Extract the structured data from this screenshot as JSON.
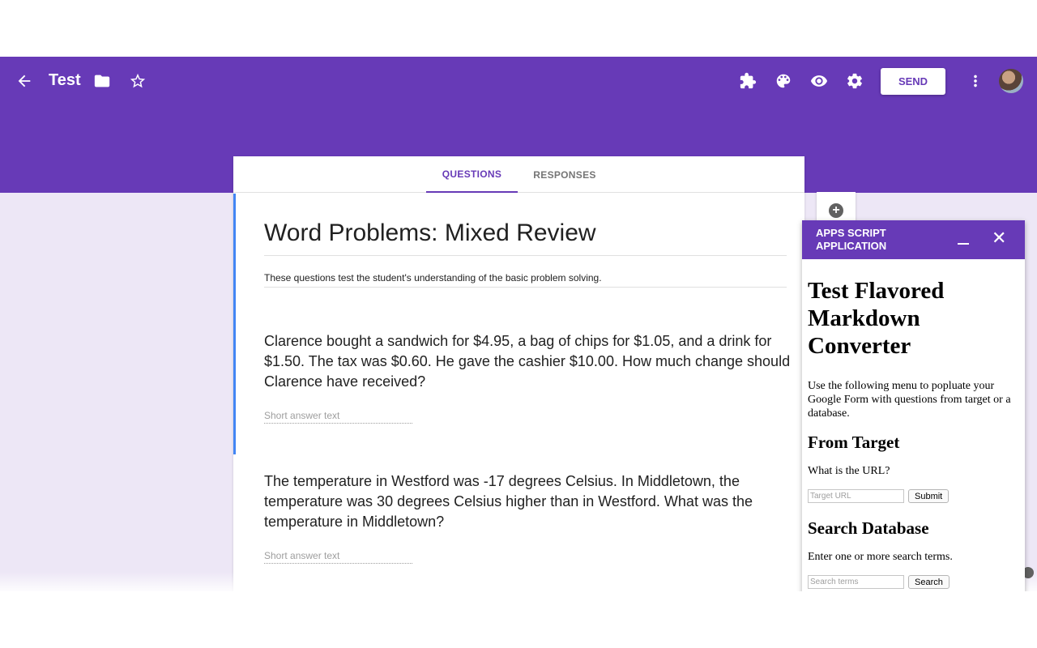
{
  "header": {
    "title": "Test",
    "send_label": "SEND",
    "icons": [
      "back-arrow-icon",
      "folder-icon",
      "star-icon",
      "addon-puzzle-icon",
      "palette-icon",
      "eye-icon",
      "gear-icon",
      "more-vert-icon"
    ]
  },
  "tabs": [
    {
      "label": "QUESTIONS",
      "active": true
    },
    {
      "label": "RESPONSES",
      "active": false
    }
  ],
  "form": {
    "title": "Word Problems: Mixed Review",
    "description": "These questions test the student's understanding of the basic problem solving.",
    "questions": [
      {
        "text": "Clarence bought a sandwich for $4.95, a bag of chips for $1.05, and a drink for $1.50. The tax was $0.60. He gave the cashier $10.00. How much change should Clarence have received?",
        "answer_placeholder": "Short answer text"
      },
      {
        "text": "The temperature in Westford was -17 degrees Celsius. In Middletown, the temperature was 30 degrees Celsius higher than in Westford. What was the temperature in Middletown?",
        "answer_placeholder": "Short answer text"
      }
    ]
  },
  "sidebar": {
    "title": "APPS SCRIPT APPLICATION",
    "heading": "Test Flavored Markdown Converter",
    "intro": "Use the following menu to popluate your Google Form with questions from target or a database.",
    "target_heading": "From Target",
    "target_prompt": "What is the URL?",
    "target_placeholder": "Target URL",
    "target_button": "Submit",
    "search_heading": "Search Database",
    "search_prompt": "Enter one or more search terms.",
    "search_placeholder": "Search terms",
    "search_button": "Search"
  },
  "colors": {
    "brand": "#673ab7",
    "background": "#ede7f6",
    "active_question": "#4285f4"
  }
}
